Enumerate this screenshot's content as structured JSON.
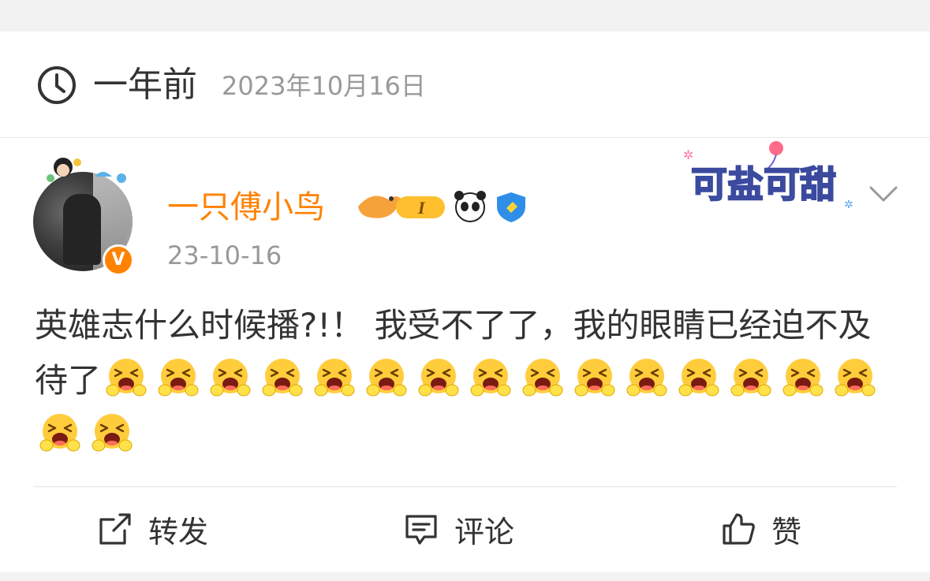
{
  "post": {
    "relative_time": "一年前",
    "absolute_date": "2023年10月16日",
    "username": "一只傅小鸟",
    "level_badge": "I",
    "verified_badge": "V",
    "post_date": "23-10-16",
    "text_part1": "英雄志什么时候播?!！ 我受不了了，我的眼睛已经迫不及待了",
    "emoji_name": "crying-emoji",
    "emoji_count": 17,
    "sticker_text": "可盐可甜"
  },
  "actions": {
    "repost_label": "转发",
    "comment_label": "评论",
    "like_label": "赞"
  },
  "colors": {
    "username": "#ff8200",
    "date": "#999999",
    "text": "#333333",
    "background": "#f2f2f2",
    "card": "#ffffff"
  }
}
